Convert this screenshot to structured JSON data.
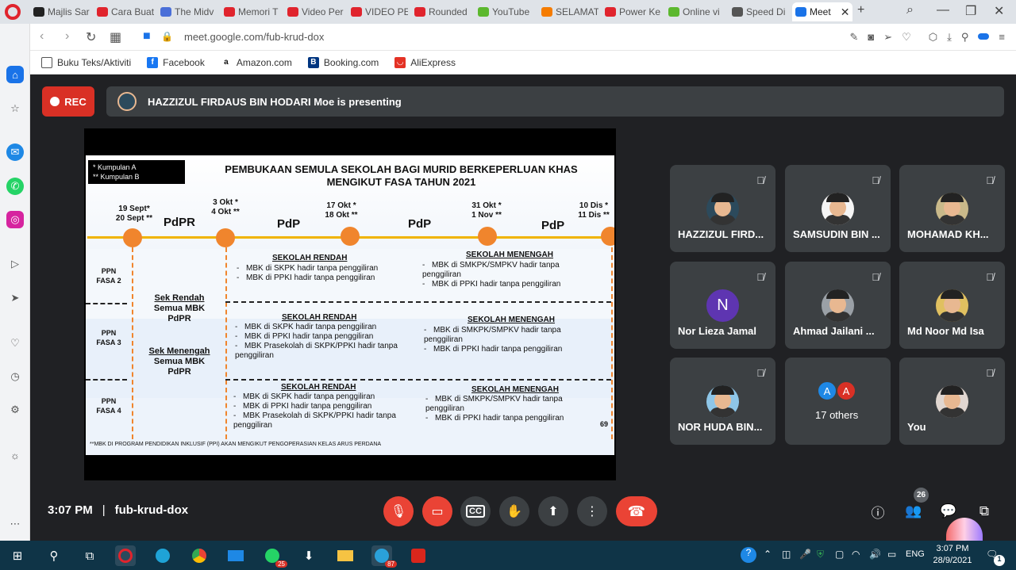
{
  "browser": {
    "tabs": [
      {
        "label": "Majlis Sar",
        "color": "#222222"
      },
      {
        "label": "Cara Buat",
        "color": "#e0242d"
      },
      {
        "label": "The Midv",
        "color": "#4a6fd8"
      },
      {
        "label": "Memori T",
        "color": "#e0242d"
      },
      {
        "label": "Video Per",
        "color": "#e0242d"
      },
      {
        "label": "VIDEO PE",
        "color": "#e0242d"
      },
      {
        "label": "Rounded",
        "color": "#e0242d"
      },
      {
        "label": "YouTube",
        "color": "#5cb82e"
      },
      {
        "label": "SELAMAT",
        "color": "#f57c00"
      },
      {
        "label": "Power Ke",
        "color": "#e0242d"
      },
      {
        "label": "Online vi",
        "color": "#5cb82e"
      },
      {
        "label": "Speed Di",
        "color": "#555555"
      },
      {
        "label": "Meet",
        "color": "#1a73e8"
      }
    ],
    "url": "meet.google.com/fub-krud-dox",
    "bookmarks": [
      {
        "label": "Buku Teks/Aktiviti",
        "icon": "folder-icon"
      },
      {
        "label": "Facebook",
        "icon": "facebook-icon"
      },
      {
        "label": "Amazon.com",
        "icon": "amazon-icon"
      },
      {
        "label": "Booking.com",
        "icon": "booking-icon"
      },
      {
        "label": "AliExpress",
        "icon": "aliexpress-icon"
      }
    ]
  },
  "meet": {
    "rec_label": "REC",
    "presenter_text": "HAZZIZUL FIRDAUS BIN HODARI Moe is presenting",
    "time": "3:07 PM",
    "separator": "|",
    "meeting_code": "fub-krud-dox",
    "people_count": "26",
    "participants": [
      {
        "name": "HAZZIZUL FIRD...",
        "muted": true,
        "avatar": "photo",
        "color": "#2c4a5c"
      },
      {
        "name": "SAMSUDIN BIN ...",
        "muted": true,
        "avatar": "photo",
        "color": "#f5f5f5"
      },
      {
        "name": "MOHAMAD KH...",
        "muted": true,
        "avatar": "photo",
        "color": "#c9b98a"
      },
      {
        "name": "Nor Lieza Jamal",
        "muted": true,
        "avatar": "letter",
        "letter": "N",
        "color": "#5e35b1"
      },
      {
        "name": "Ahmad Jailani ...",
        "muted": true,
        "avatar": "photo",
        "color": "#9aa0a6"
      },
      {
        "name": "Md Noor Md Isa",
        "muted": true,
        "avatar": "photo",
        "color": "#e0c060"
      },
      {
        "name": "NOR HUDA BIN...",
        "muted": true,
        "avatar": "photo",
        "color": "#8ec6e8"
      },
      {
        "name": "17 others",
        "muted": false,
        "avatar": "group",
        "letters": [
          "A",
          "A"
        ],
        "colors": [
          "#1e88e5",
          "#d93025"
        ]
      },
      {
        "name": "You",
        "muted": true,
        "avatar": "photo",
        "color": "#e0d6d0"
      }
    ]
  },
  "slide": {
    "legend": [
      "*  Kumpulan A",
      "** Kumpulan B"
    ],
    "title_line1": "PEMBUKAAN SEMULA SEKOLAH BAGI MURID BERKEPERLUAN KHAS",
    "title_line2": "MENGIKUT FASA TAHUN 2021",
    "dates": [
      {
        "l1": "19 Sept*",
        "l2": "20 Sept **"
      },
      {
        "l1": "3 Okt *",
        "l2": "4 Okt **"
      },
      {
        "l1": "17    Okt *",
        "l2": "18    Okt **"
      },
      {
        "l1": "31 Okt *",
        "l2": "1 Nov **"
      },
      {
        "l1": "10 Dis *",
        "l2": "11 Dis **"
      }
    ],
    "modes": [
      "PdPR",
      "PdP",
      "PdP",
      "PdP"
    ],
    "rows": [
      {
        "l1": "PPN",
        "l2": "FASA 2"
      },
      {
        "l1": "PPN",
        "l2": "FASA 3"
      },
      {
        "l1": "PPN",
        "l2": "FASA 4"
      }
    ],
    "mbk_rendah": {
      "l1": "Sek Rendah",
      "l2": "Semua MBK",
      "l3": "PdPR"
    },
    "mbk_menengah": {
      "l1": "Sek Menengah",
      "l2": "Semua MBK",
      "l3": "PdPR"
    },
    "f2_rendah": {
      "head": "SEKOLAH RENDAH",
      "items": [
        "MBK di SKPK hadir tanpa penggiliran",
        "MBK di PPKI hadir tanpa penggiliran"
      ]
    },
    "f2_menengah": {
      "head": "SEKOLAH MENENGAH",
      "items": [
        "MBK di SMKPK/SMPKV hadir tanpa penggiliran",
        "MBK di PPKI hadir tanpa penggiliran"
      ]
    },
    "f3_rendah": {
      "head": "SEKOLAH RENDAH",
      "items": [
        "MBK di SKPK hadir tanpa penggiliran",
        "MBK di PPKI hadir tanpa penggiliran",
        "MBK Prasekolah di SKPK/PPKI hadir tanpa penggiliran"
      ]
    },
    "f3_menengah": {
      "head": "SEKOLAH MENENGAH",
      "items": [
        "MBK di SMKPK/SMPKV hadir tanpa penggiliran",
        "MBK di PPKI hadir tanpa penggiliran"
      ]
    },
    "f4_rendah": {
      "head": "SEKOLAH RENDAH",
      "items": [
        "MBK di SKPK hadir tanpa penggiliran",
        "MBK di PPKI hadir tanpa penggiliran",
        "MBK Prasekolah di SKPK/PPKI hadir tanpa penggiliran"
      ]
    },
    "f4_menengah": {
      "head": "SEKOLAH MENENGAH",
      "items": [
        "MBK di SMKPK/SMPKV hadir tanpa penggiliran",
        "MBK di PPKI hadir tanpa penggiliran"
      ]
    },
    "footnote": "**MBK DI PROGRAM PENDIDIKAN INKLUSIF (PPI) AKAN MENGIKUT PENGOPERASIAN KELAS ARUS PERDANA",
    "page_number": "69"
  },
  "taskbar": {
    "clock_time": "3:07 PM",
    "clock_date": "28/9/2021",
    "lang": "ENG",
    "whatsapp_badge": "25",
    "telegram_badge": "87",
    "notif_badge": "1"
  }
}
